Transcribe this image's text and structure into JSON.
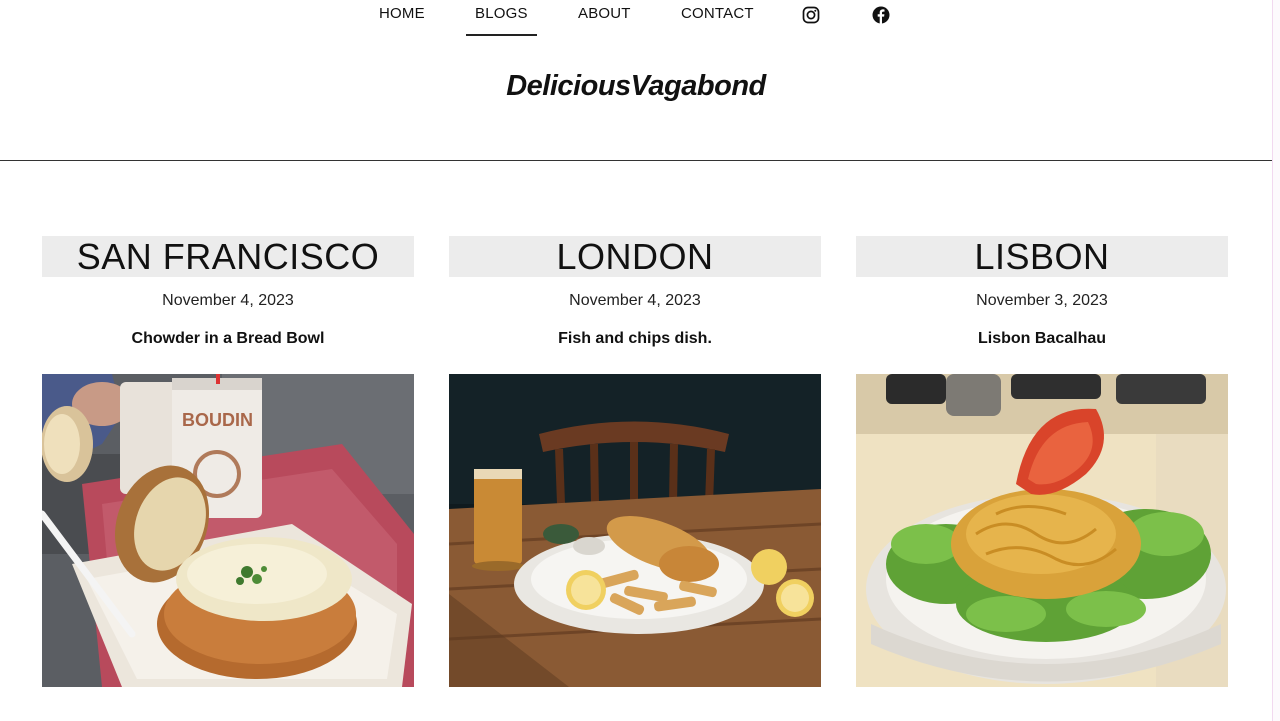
{
  "nav": {
    "items": [
      {
        "label": "HOME",
        "active": false
      },
      {
        "label": "BLOGS",
        "active": true
      },
      {
        "label": "ABOUT",
        "active": false
      },
      {
        "label": "CONTACT",
        "active": false
      }
    ],
    "icons": [
      "instagram-icon",
      "facebook-icon"
    ]
  },
  "site": {
    "brand": "DeliciousVagabond"
  },
  "posts": [
    {
      "city": "SAN FRANCISCO",
      "date": "November 4, 2023",
      "caption": "Chowder in a Bread Bowl",
      "cup_text": "BOUDIN"
    },
    {
      "city": "LONDON",
      "date": "November 4, 2023",
      "caption": "Fish and chips dish."
    },
    {
      "city": "LISBON",
      "date": "November 3, 2023",
      "caption": "Lisbon Bacalhau"
    }
  ],
  "colors": {
    "title_bg": "#ececec",
    "rule": "#333333",
    "text": "#111111"
  }
}
